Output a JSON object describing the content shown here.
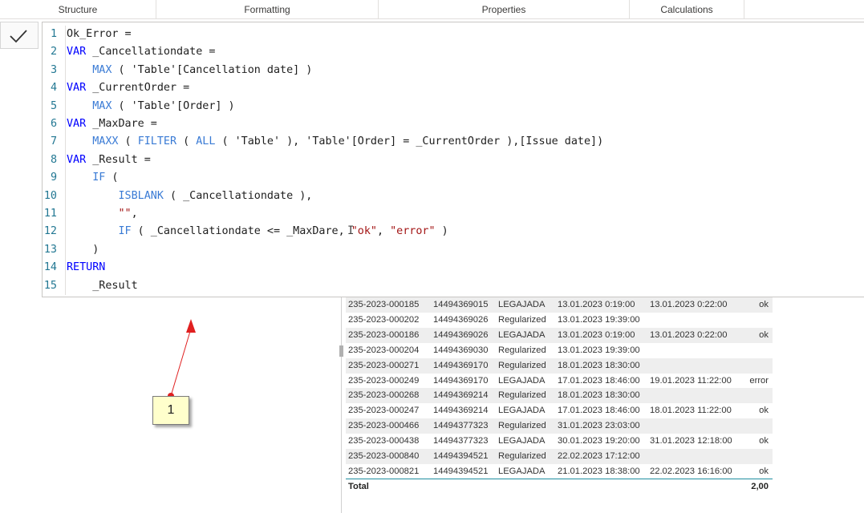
{
  "ribbon": {
    "tabs": [
      {
        "label": "Structure"
      },
      {
        "label": "Formatting"
      },
      {
        "label": "Properties"
      },
      {
        "label": "Calculations"
      }
    ]
  },
  "formula_bar": {
    "commit_icon": "checkmark-icon",
    "lines": [
      {
        "n": "1",
        "segs": [
          {
            "t": "Ok_Error =",
            "c": "txt"
          }
        ]
      },
      {
        "n": "2",
        "segs": [
          {
            "t": "VAR",
            "c": "kw"
          },
          {
            "t": " _Cancellationdate =",
            "c": "txt"
          }
        ]
      },
      {
        "n": "3",
        "segs": [
          {
            "t": "    ",
            "c": "txt"
          },
          {
            "t": "MAX",
            "c": "fn"
          },
          {
            "t": " ( 'Table'[Cancellation date] )",
            "c": "txt"
          }
        ]
      },
      {
        "n": "4",
        "segs": [
          {
            "t": "VAR",
            "c": "kw"
          },
          {
            "t": " _CurrentOrder =",
            "c": "txt"
          }
        ]
      },
      {
        "n": "5",
        "segs": [
          {
            "t": "    ",
            "c": "txt"
          },
          {
            "t": "MAX",
            "c": "fn"
          },
          {
            "t": " ( 'Table'[Order] )",
            "c": "txt"
          }
        ]
      },
      {
        "n": "6",
        "segs": [
          {
            "t": "VAR",
            "c": "kw"
          },
          {
            "t": " _MaxDare =",
            "c": "txt"
          }
        ]
      },
      {
        "n": "7",
        "segs": [
          {
            "t": "    ",
            "c": "txt"
          },
          {
            "t": "MAXX",
            "c": "fn"
          },
          {
            "t": " ( ",
            "c": "txt"
          },
          {
            "t": "FILTER",
            "c": "fn"
          },
          {
            "t": " ( ",
            "c": "txt"
          },
          {
            "t": "ALL",
            "c": "fn"
          },
          {
            "t": " ( 'Table' ), 'Table'[Order] = _CurrentOrder ),[Issue date])",
            "c": "txt"
          }
        ]
      },
      {
        "n": "8",
        "segs": [
          {
            "t": "VAR",
            "c": "kw"
          },
          {
            "t": " _Result =",
            "c": "txt"
          }
        ]
      },
      {
        "n": "9",
        "segs": [
          {
            "t": "    ",
            "c": "txt"
          },
          {
            "t": "IF",
            "c": "fn"
          },
          {
            "t": " (",
            "c": "txt"
          }
        ]
      },
      {
        "n": "10",
        "segs": [
          {
            "t": "        ",
            "c": "txt"
          },
          {
            "t": "ISBLANK",
            "c": "fn"
          },
          {
            "t": " ( _Cancellationdate ),",
            "c": "txt"
          }
        ]
      },
      {
        "n": "11",
        "segs": [
          {
            "t": "        ",
            "c": "txt"
          },
          {
            "t": "\"\"",
            "c": "str"
          },
          {
            "t": ",",
            "c": "txt"
          }
        ]
      },
      {
        "n": "12",
        "segs": [
          {
            "t": "        ",
            "c": "txt"
          },
          {
            "t": "IF",
            "c": "fn"
          },
          {
            "t": " ( _Cancellationdate <= _MaxDare, ",
            "c": "txt"
          },
          {
            "t": "\"ok\"",
            "c": "str"
          },
          {
            "t": ", ",
            "c": "txt"
          },
          {
            "t": "\"error\"",
            "c": "str"
          },
          {
            "t": " )",
            "c": "txt"
          }
        ]
      },
      {
        "n": "13",
        "segs": [
          {
            "t": "    )",
            "c": "txt"
          }
        ]
      },
      {
        "n": "14",
        "segs": [
          {
            "t": "RETURN",
            "c": "kw"
          }
        ]
      },
      {
        "n": "15",
        "segs": [
          {
            "t": "    _Result",
            "c": "txt"
          }
        ]
      }
    ]
  },
  "table": {
    "rows": [
      {
        "c1": "235-2023-000185",
        "c2": "14494369015",
        "c3": "LEGAJADA",
        "c4": "13.01.2023 0:19:00",
        "c5": "13.01.2023 0:22:00",
        "c6": "ok"
      },
      {
        "c1": "235-2023-000202",
        "c2": "14494369026",
        "c3": "Regularized",
        "c4": "13.01.2023 19:39:00",
        "c5": "",
        "c6": ""
      },
      {
        "c1": "235-2023-000186",
        "c2": "14494369026",
        "c3": "LEGAJADA",
        "c4": "13.01.2023 0:19:00",
        "c5": "13.01.2023 0:22:00",
        "c6": "ok"
      },
      {
        "c1": "235-2023-000204",
        "c2": "14494369030",
        "c3": "Regularized",
        "c4": "13.01.2023 19:39:00",
        "c5": "",
        "c6": ""
      },
      {
        "c1": "235-2023-000271",
        "c2": "14494369170",
        "c3": "Regularized",
        "c4": "18.01.2023 18:30:00",
        "c5": "",
        "c6": ""
      },
      {
        "c1": "235-2023-000249",
        "c2": "14494369170",
        "c3": "LEGAJADA",
        "c4": "17.01.2023 18:46:00",
        "c5": "19.01.2023 11:22:00",
        "c6": "error"
      },
      {
        "c1": "235-2023-000268",
        "c2": "14494369214",
        "c3": "Regularized",
        "c4": "18.01.2023 18:30:00",
        "c5": "",
        "c6": ""
      },
      {
        "c1": "235-2023-000247",
        "c2": "14494369214",
        "c3": "LEGAJADA",
        "c4": "17.01.2023 18:46:00",
        "c5": "18.01.2023 11:22:00",
        "c6": "ok"
      },
      {
        "c1": "235-2023-000466",
        "c2": "14494377323",
        "c3": "Regularized",
        "c4": "31.01.2023 23:03:00",
        "c5": "",
        "c6": ""
      },
      {
        "c1": "235-2023-000438",
        "c2": "14494377323",
        "c3": "LEGAJADA",
        "c4": "30.01.2023 19:20:00",
        "c5": "31.01.2023 12:18:00",
        "c6": "ok"
      },
      {
        "c1": "235-2023-000840",
        "c2": "14494394521",
        "c3": "Regularized",
        "c4": "22.02.2023 17:12:00",
        "c5": "",
        "c6": ""
      },
      {
        "c1": "235-2023-000821",
        "c2": "14494394521",
        "c3": "LEGAJADA",
        "c4": "21.01.2023 18:38:00",
        "c5": "22.02.2023 16:16:00",
        "c6": "ok"
      }
    ],
    "total": {
      "label": "Total",
      "value": "2,00"
    }
  },
  "annotation": {
    "callout_label": "1",
    "color": "#e02020"
  }
}
